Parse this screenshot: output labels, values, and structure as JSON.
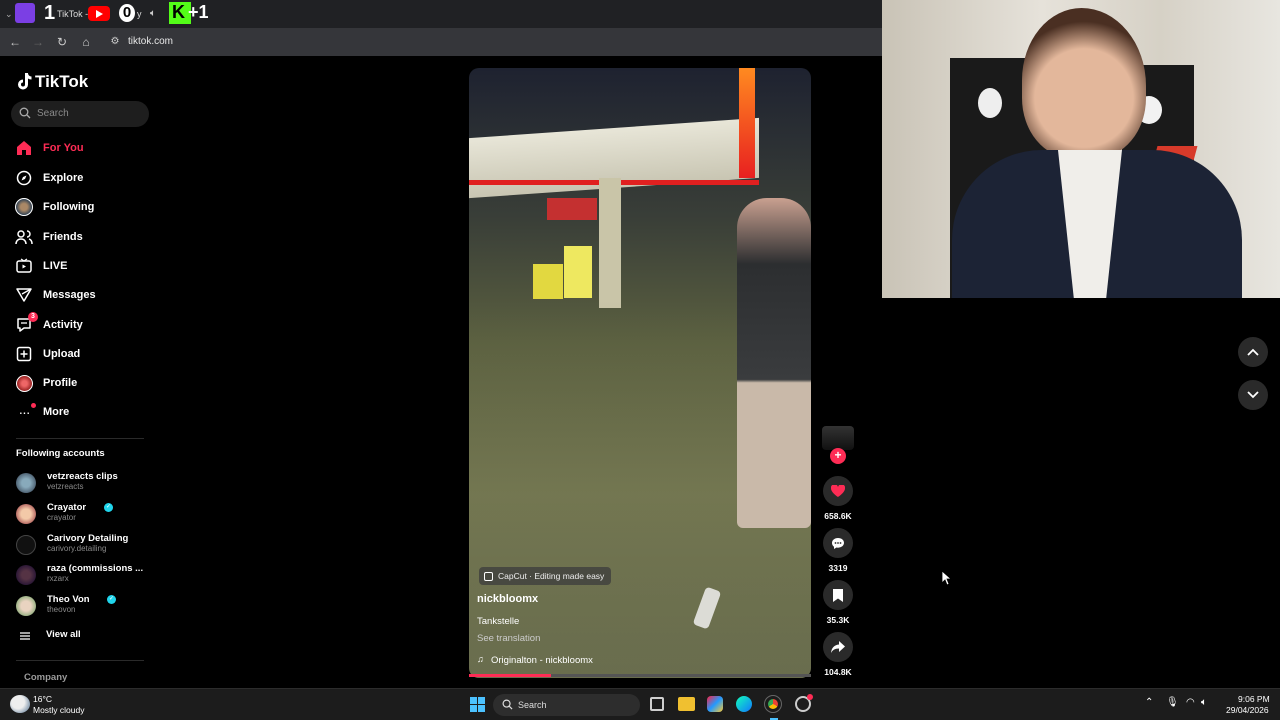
{
  "browser": {
    "tab_title": "TikTok - ",
    "tab_suffix": "y",
    "badge_a": "1",
    "badge_b": "0",
    "badge_c": "+1",
    "url": "tiktok.com"
  },
  "sidebar": {
    "logo": "TikTok",
    "search_placeholder": "Search",
    "nav": [
      {
        "label": "For You",
        "icon": "home-icon",
        "active": true
      },
      {
        "label": "Explore",
        "icon": "compass-icon"
      },
      {
        "label": "Following",
        "icon": "following-avatar-icon"
      },
      {
        "label": "Friends",
        "icon": "friends-icon"
      },
      {
        "label": "LIVE",
        "icon": "live-icon"
      },
      {
        "label": "Messages",
        "icon": "messages-icon"
      },
      {
        "label": "Activity",
        "icon": "activity-icon",
        "badge": "3"
      },
      {
        "label": "Upload",
        "icon": "upload-icon"
      },
      {
        "label": "Profile",
        "icon": "profile-icon"
      },
      {
        "label": "More",
        "icon": "more-icon"
      }
    ],
    "following_title": "Following accounts",
    "accounts": [
      {
        "name": "vetzreacts clips",
        "handle": "vetzreacts",
        "verified": false
      },
      {
        "name": "Crayator",
        "handle": "crayator",
        "verified": true
      },
      {
        "name": "Carivory Detailing",
        "handle": "carivory.detailing",
        "verified": false
      },
      {
        "name": "raza (commissions ...",
        "handle": "rxzarx",
        "verified": false
      },
      {
        "name": "Theo Von",
        "handle": "theovon",
        "verified": true
      }
    ],
    "view_all": "View all",
    "company": "Company"
  },
  "video": {
    "capcut_label": "CapCut · Editing made easy",
    "author": "nickbloomx",
    "caption": "Tankstelle",
    "see_translation": "See translation",
    "sound": "Originalton - nickbloomx",
    "progress": 0.24
  },
  "actions": {
    "likes": "658.6K",
    "comments": "3319",
    "saves": "35.3K",
    "shares": "104.8K"
  },
  "taskbar": {
    "temp": "16°C",
    "weather": "Mostly cloudy",
    "search": "Search",
    "time": "9:06 PM",
    "date": "29/04/2026"
  },
  "colors": {
    "accent": "#fe2c55",
    "verified": "#20d5ec"
  }
}
